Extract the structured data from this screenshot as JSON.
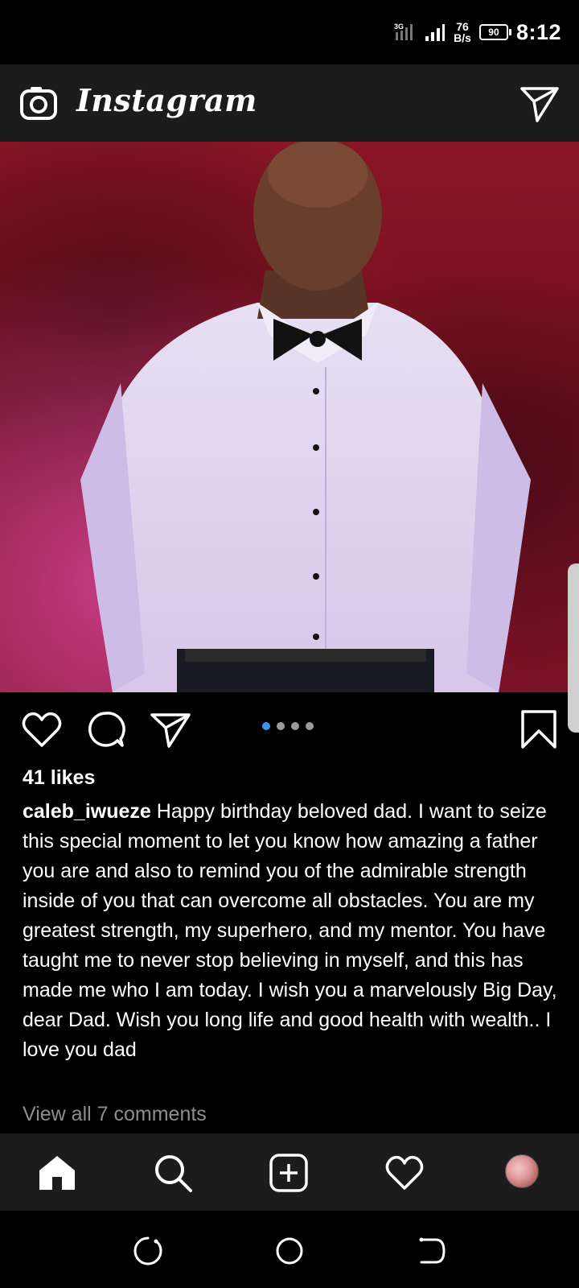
{
  "status_bar": {
    "time": "8:12",
    "net_speed_value": "76",
    "net_speed_unit": "B/s",
    "battery": "90",
    "icons": [
      "3g-icon",
      "signal-icon",
      "signal-icon",
      "battery-icon"
    ]
  },
  "header": {
    "brand": "Instagram",
    "left_icon": "camera-icon",
    "right_icon": "direct-send-icon"
  },
  "post": {
    "image_alt": "post photo",
    "carousel_dots": 4,
    "active_dot": 0,
    "likes": "41 likes",
    "author": "caleb_iwueze",
    "caption": "Happy birthday beloved dad. I want to seize this special moment to let you know how amazing a father you are and also to remind you of the admirable strength inside of you that can overcome all obstacles. You are my greatest strength, my superhero, and my mentor. You have taught me to never stop believing in myself, and this has made me who I am today. I wish you a marvelously Big Day, dear Dad. Wish you long life and good health with wealth.. I love you dad",
    "view_comments": "View all 7 comments",
    "actions": [
      "like-icon",
      "comment-icon",
      "share-icon",
      "save-icon"
    ]
  },
  "bottom_nav": {
    "items": [
      "home-icon",
      "search-icon",
      "add-post-icon",
      "activity-icon",
      "profile-avatar"
    ]
  },
  "system_nav": {
    "items": [
      "recents-icon",
      "home-circle-icon",
      "back-icon"
    ]
  },
  "colors": {
    "background": "#000000",
    "bar": "#1c1c1c",
    "accent_blue": "#3897f0",
    "muted_text": "#8e8e8e"
  }
}
